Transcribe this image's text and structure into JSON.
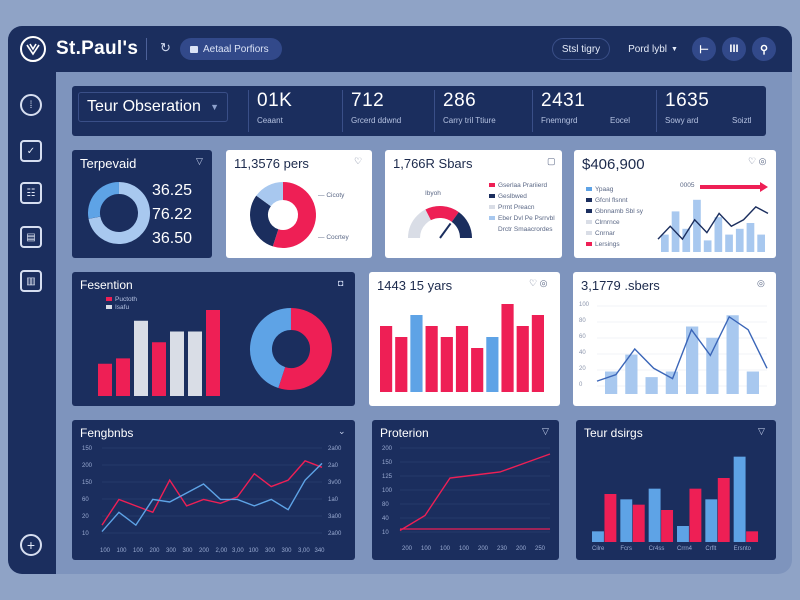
{
  "app": {
    "brand": "St.Paul's"
  },
  "topbar": {
    "refresh_glyph": "↻",
    "pill_label": "Aetaal Porfiors",
    "btn1_label": "Stsl tigry",
    "btn2_label": "Pord lybl",
    "circle_btns": [
      "⊢",
      "III",
      "⚲"
    ]
  },
  "kpi": {
    "select_label": "Teur Obseration",
    "items": [
      {
        "value": "01K",
        "label": "Ceaant"
      },
      {
        "value": "712",
        "label": "Grcerd ddwnd"
      },
      {
        "value": "286",
        "label": "Carry tril Ttiure"
      },
      {
        "value": "2431",
        "label": "Fnemngrd"
      },
      {
        "value": "1635",
        "label": "Sowy ard"
      }
    ],
    "extra_labels": [
      "Eocel",
      "Soiztl"
    ]
  },
  "cards": {
    "c1": {
      "title": "Terpevaid",
      "icon": "▽",
      "stats": [
        "36.25",
        "76.22",
        "36.50"
      ],
      "donut": {
        "value": 0.72
      }
    },
    "c2": {
      "title": "11,3576 pers",
      "icon": "♡",
      "legend": [
        "Cicoty",
        "Cocrtey"
      ],
      "donut": {
        "segments": [
          0.55,
          0.3,
          0.15
        ]
      }
    },
    "c3": {
      "title": "1,766R Sbars",
      "icon": "▢",
      "gauge_label": "Ibyoh",
      "gauge": {
        "value": 0.7
      },
      "legend": [
        "Gserlaa Prariierd",
        "Geslbwed",
        "Prrnt Preacn",
        "Eber Dvl Pe Psrrvbl",
        "Drctr Smaacrordes"
      ]
    },
    "c4": {
      "title": "$406,900",
      "icons": "♡ ◎",
      "arrow_label": "0005",
      "legend": [
        "Ypaag",
        "Gfcnl flsnnt",
        "Gbnnamb Sbl sy",
        "Clrnrnce",
        "Cnrnar",
        "Lersings"
      ],
      "bars": [
        3,
        7,
        4,
        9,
        2,
        6,
        3,
        4,
        5,
        3
      ],
      "line": [
        2,
        4,
        2,
        5,
        3,
        6,
        4,
        5,
        7,
        6
      ]
    },
    "c5": {
      "title": "Fesention",
      "icon": "◘",
      "legend": [
        "Puctoth",
        "Isafu"
      ],
      "bars": [
        3,
        3.5,
        7,
        5,
        6,
        6,
        8
      ],
      "donut": {
        "segments": [
          0.55,
          0.45
        ]
      }
    },
    "c6": {
      "title": "1443 15 yars",
      "icons": "♡ ◎",
      "bars": [
        6,
        5,
        7,
        6,
        5,
        6,
        4,
        5,
        8,
        6,
        7
      ]
    },
    "c7": {
      "title": "3,1779 .sbers",
      "icon": "◎",
      "ticks": [
        "100",
        "80",
        "60",
        "40",
        "20",
        "0"
      ],
      "bars": [
        2,
        3.5,
        1.5,
        2,
        6,
        5,
        7,
        2
      ],
      "line": [
        1,
        1.5,
        3.5,
        2,
        1.2,
        5,
        3,
        6,
        5,
        2
      ]
    },
    "c8": {
      "title": "Fengbnbs",
      "icon": "⌄",
      "yticks": [
        "150",
        "200",
        "150",
        "60",
        "20",
        "10"
      ],
      "xticks": [
        "100",
        "100",
        "100",
        "200",
        "300",
        "300",
        "200",
        "2,00",
        "3,00",
        "100",
        "300",
        "300",
        "3,00",
        "340"
      ],
      "yticks_r": [
        "2a00",
        "2a0",
        "3v00",
        "1a0",
        "3a00",
        "2a00"
      ],
      "series_red": [
        1,
        3,
        2.5,
        2,
        4.5,
        2.5,
        3,
        2.7,
        3.2,
        5,
        4,
        4.5,
        6,
        5.5
      ],
      "series_blue": [
        0.5,
        2,
        1,
        3,
        2.8,
        3.5,
        4.2,
        3,
        3,
        2.5,
        3,
        2.2,
        4.5,
        5.8
      ]
    },
    "c9": {
      "title": "Proterion",
      "icon": "▽",
      "yticks": [
        "200",
        "150",
        "125",
        "100",
        "80",
        "40",
        "10"
      ],
      "xticks": [
        "200",
        "100",
        "100",
        "100",
        "200",
        "230",
        "200",
        "250"
      ],
      "series_red": [
        0.5,
        1.5,
        4,
        4.2,
        4.4,
        5,
        5.6
      ],
      "series_red2": [
        0.6,
        0.6,
        0.6,
        0.6,
        0.6,
        0.6,
        0.6
      ]
    },
    "c10": {
      "title": "Teur dsirgs",
      "icon": "▽",
      "xticks": [
        "Cilre",
        "Fcrs",
        "Cr4ss",
        "Crrn4",
        "Crflt",
        "Ersnto"
      ],
      "bars_blue": [
        1,
        4,
        5,
        1.5,
        4,
        8
      ],
      "bars_red": [
        4.5,
        3.5,
        3,
        5,
        6,
        1
      ]
    }
  },
  "colors": {
    "navy": "#1b2e5e",
    "red": "#ee1f55",
    "blue": "#5ea3e6",
    "pale": "#a8c8ef",
    "grey": "#d9dde6"
  }
}
